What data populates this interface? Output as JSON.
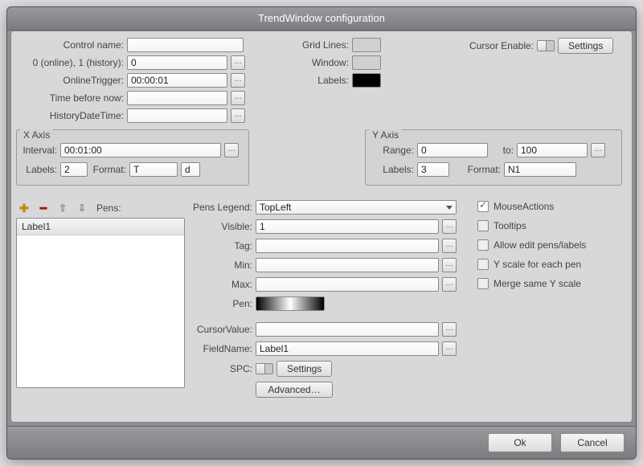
{
  "window": {
    "title": "TrendWindow configuration"
  },
  "top": {
    "control_name_label": "Control name:",
    "control_name": "",
    "mode_label": "0 (online), 1 (history):",
    "mode": "0",
    "online_trigger_label": "OnlineTrigger:",
    "online_trigger": "00:00:01",
    "time_before_now_label": "Time before now:",
    "time_before_now": "",
    "history_dt_label": "HistoryDateTime:",
    "history_dt": "",
    "gridlines_label": "Grid Lines:",
    "window_color_label": "Window:",
    "labels_color_label": "Labels:",
    "cursor_enable_label": "Cursor Enable:",
    "settings_btn": "Settings",
    "grid_color": "#d0d0d3",
    "window_color": "#d0d0d3",
    "labels_color": "#000000"
  },
  "xaxis": {
    "title": "X Axis",
    "interval_label": "Interval:",
    "interval": "00:01:00",
    "labels_label": "Labels:",
    "labels": "2",
    "format_label": "Format:",
    "format": "T",
    "format2": "d"
  },
  "yaxis": {
    "title": "Y Axis",
    "range_label": "Range:",
    "range_from": "0",
    "to_label": "to:",
    "range_to": "100",
    "labels_label": "Labels:",
    "labels": "3",
    "format_label": "Format:",
    "format": "N1"
  },
  "pens_panel": {
    "pens_label": "Pens:",
    "list": [
      "Label1"
    ],
    "legend_label": "Pens Legend:",
    "legend_value": "TopLeft",
    "visible_label": "Visible:",
    "visible": "1",
    "tag_label": "Tag:",
    "tag": "",
    "min_label": "Min:",
    "min": "",
    "max_label": "Max:",
    "max": "",
    "pen_label": "Pen:",
    "cursor_value_label": "CursorValue:",
    "cursor_value": "",
    "fieldname_label": "FieldName:",
    "fieldname": "Label1",
    "spc_label": "SPC:",
    "spc_settings_btn": "Settings",
    "advanced_btn": "Advanced…"
  },
  "checks": {
    "mouse_actions": "MouseActions",
    "tooltips": "Tooltips",
    "allow_edit": "Allow edit pens/labels",
    "y_each": "Y scale for each pen",
    "merge_y": "Merge same Y scale"
  },
  "footer": {
    "ok": "Ok",
    "cancel": "Cancel"
  }
}
